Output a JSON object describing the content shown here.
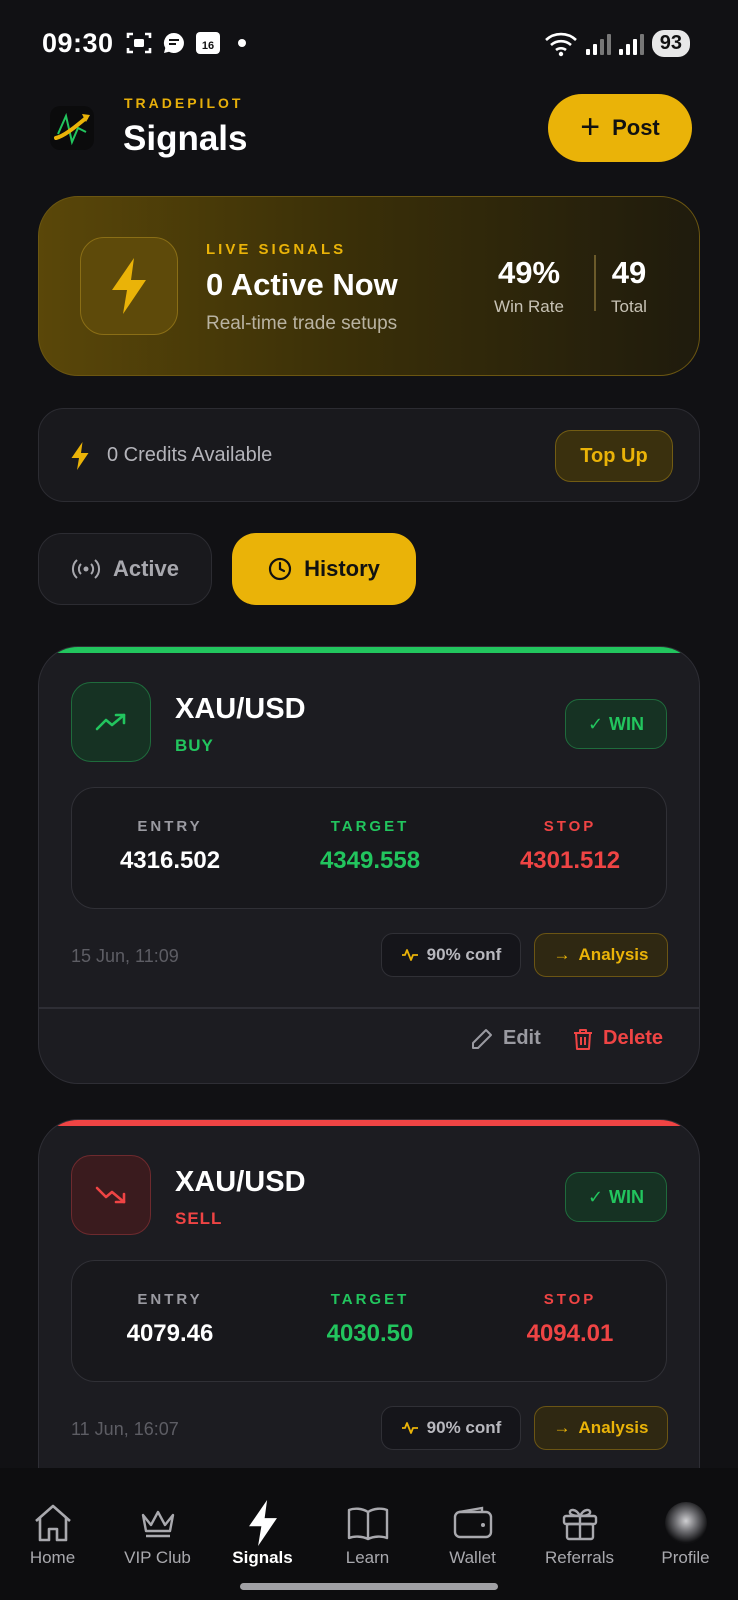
{
  "status_bar": {
    "time": "09:30",
    "calendar_day": "16",
    "battery": "93"
  },
  "header": {
    "brand": "TRADEPILOT",
    "title": "Signals",
    "post_label": "Post"
  },
  "live": {
    "label": "LIVE SIGNALS",
    "count_text": "0 Active Now",
    "subtitle": "Real-time trade setups",
    "win_rate_value": "49%",
    "win_rate_label": "Win Rate",
    "total_value": "49",
    "total_label": "Total"
  },
  "credits": {
    "text": "0 Credits Available",
    "topup_label": "Top Up"
  },
  "tabs": {
    "active_label": "Active",
    "history_label": "History"
  },
  "signals": [
    {
      "pair": "XAU/USD",
      "side": "BUY",
      "result": "WIN",
      "entry_label": "ENTRY",
      "entry": "4316.502",
      "target_label": "TARGET",
      "target": "4349.558",
      "stop_label": "STOP",
      "stop": "4301.512",
      "date": "15 Jun, 11:09",
      "confidence": "90% conf",
      "analysis_label": "Analysis",
      "edit_label": "Edit",
      "delete_label": "Delete"
    },
    {
      "pair": "XAU/USD",
      "side": "SELL",
      "result": "WIN",
      "entry_label": "ENTRY",
      "entry": "4079.46",
      "target_label": "TARGET",
      "target": "4030.50",
      "stop_label": "STOP",
      "stop": "4094.01",
      "date": "11 Jun, 16:07",
      "confidence": "90% conf",
      "analysis_label": "Analysis"
    }
  ],
  "nav": {
    "items": [
      {
        "label": "Home",
        "icon": "home-icon"
      },
      {
        "label": "VIP Club",
        "icon": "crown-icon"
      },
      {
        "label": "Signals",
        "icon": "bolt-icon"
      },
      {
        "label": "Learn",
        "icon": "book-icon"
      },
      {
        "label": "Wallet",
        "icon": "wallet-icon"
      },
      {
        "label": "Referrals",
        "icon": "gift-icon"
      },
      {
        "label": "Profile",
        "icon": "avatar-icon"
      }
    ],
    "active": "Signals"
  },
  "colors": {
    "accent": "#eab308",
    "buy": "#22c55e",
    "sell": "#ef4444",
    "background": "#111114"
  }
}
